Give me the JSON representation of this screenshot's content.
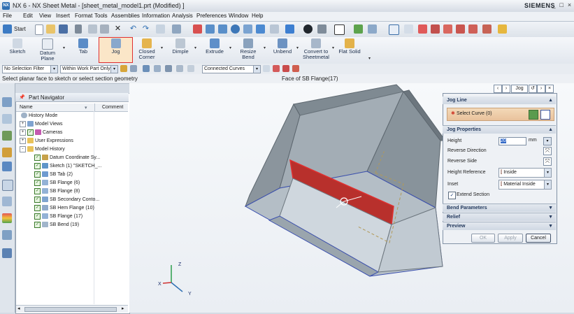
{
  "window": {
    "title": "NX 6 - NX Sheet Metal - [sheet_metal_model1.prt (Modified) ]",
    "brand": "SIEMENS",
    "controls": [
      "_",
      "□",
      "×"
    ]
  },
  "menu": [
    "File",
    "Edit",
    "View",
    "Insert",
    "Format",
    "Tools",
    "Assemblies",
    "Information",
    "Analysis",
    "Preferences",
    "Window",
    "Help"
  ],
  "toolbar": {
    "start_label": "Start"
  },
  "ribbon": [
    {
      "label": "Sketch",
      "label2": ""
    },
    {
      "label": "Datum",
      "label2": "Plane"
    },
    {
      "label": "Tab",
      "label2": ""
    },
    {
      "label": "Jog",
      "label2": "",
      "selected": true
    },
    {
      "label": "Closed",
      "label2": "Corner"
    },
    {
      "label": "Dimple",
      "label2": ""
    },
    {
      "label": "Extrude",
      "label2": ""
    },
    {
      "label": "Resize",
      "label2": "Bend"
    },
    {
      "label": "Unbend",
      "label2": ""
    },
    {
      "label": "Convert to",
      "label2": "Sheetmetal"
    },
    {
      "label": "Flat Solid",
      "label2": ""
    }
  ],
  "selection_bar": {
    "filter": "No Selection Filter",
    "scope": "Within Work Part Only",
    "curve_rule": "Connected Curves"
  },
  "cue_line": "Select planar face to sketch or select section geometry",
  "status_line": "Face of SB Flange(17)",
  "navigator": {
    "title": "Part Navigator",
    "columns": {
      "name": "Name",
      "comment": "Comment"
    },
    "nodes": [
      {
        "label": "History Mode",
        "expander": "",
        "checked": false
      },
      {
        "label": "Model Views",
        "expander": "+",
        "checked": false
      },
      {
        "label": "Cameras",
        "expander": "+",
        "checked": true
      },
      {
        "label": "User Expressions",
        "expander": "+",
        "checked": false
      },
      {
        "label": "Model History",
        "expander": "-",
        "checked": false
      },
      {
        "label": "Datum Coordinate Sy...",
        "expander": "",
        "checked": true
      },
      {
        "label": "Sketch (1) \"SKETCH_...",
        "expander": "",
        "checked": true
      },
      {
        "label": "SB Tab (2)",
        "expander": "",
        "checked": true
      },
      {
        "label": "SB Flange (6)",
        "expander": "",
        "checked": true
      },
      {
        "label": "SB Flange (8)",
        "expander": "",
        "checked": true
      },
      {
        "label": "SB Secondary Conto...",
        "expander": "",
        "checked": true
      },
      {
        "label": "SB Hem Flange (10)",
        "expander": "",
        "checked": true
      },
      {
        "label": "SB Flange (17)",
        "expander": "",
        "checked": true
      },
      {
        "label": "SB Bend (19)",
        "expander": "",
        "checked": true
      }
    ]
  },
  "dialog": {
    "title": "Jog",
    "sections": {
      "jog_line": "Jog Line",
      "jog_properties": "Jog Properties",
      "bend_parameters": "Bend Parameters",
      "relief": "Relief",
      "preview": "Preview"
    },
    "select_curve": "Select Curve (0)",
    "fields": {
      "height_label": "Height",
      "height_value": "20",
      "height_unit": "mm",
      "reverse_direction": "Reverse Direction",
      "reverse_side": "Reverse Side",
      "height_reference_label": "Height Reference",
      "height_reference_value": "Inside",
      "inset_label": "Inset",
      "inset_value": "Material Inside",
      "extend_section": "Extend Section"
    },
    "buttons": {
      "ok": "OK",
      "apply": "Apply",
      "cancel": "Cancel"
    }
  },
  "triad": {
    "x": "X",
    "y": "Y",
    "z": "Z"
  },
  "colors": {
    "accent": "#2f6fb3",
    "selected_face": "#b8302c",
    "model_body": "#9aa5ad",
    "jog_highlight": "#e03030"
  }
}
